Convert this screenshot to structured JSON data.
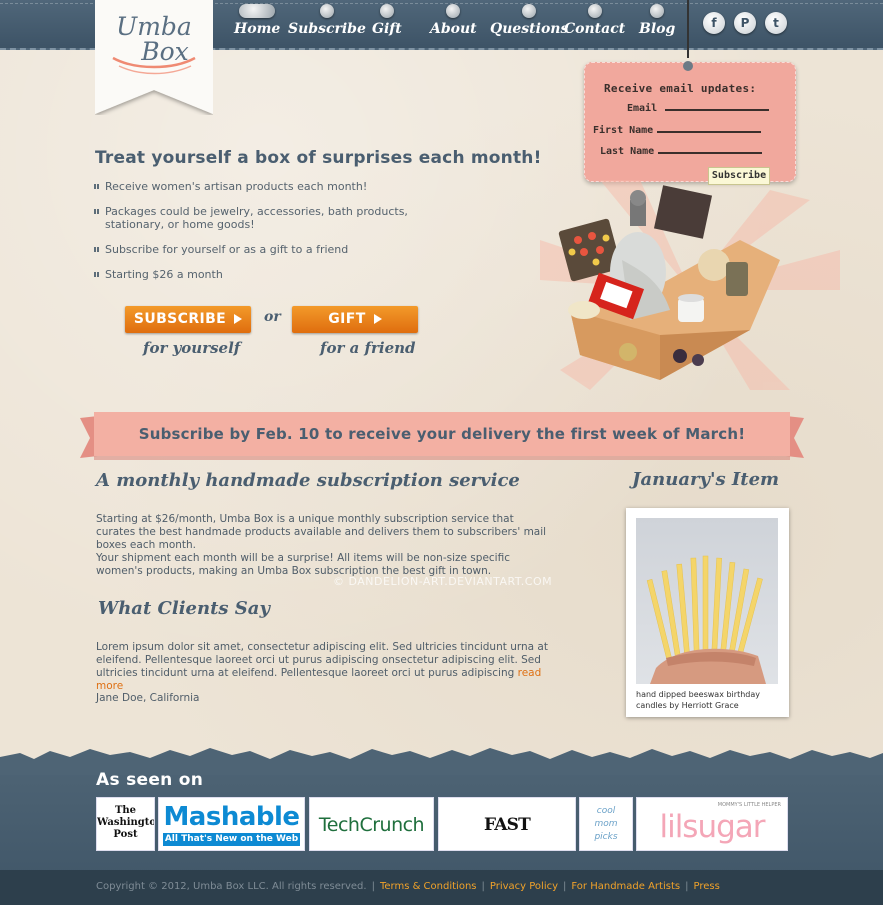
{
  "brand": {
    "logo_line1": "Umba",
    "logo_line2": "Box"
  },
  "nav": {
    "items": [
      {
        "label": "Home",
        "active": true
      },
      {
        "label": "Subscribe"
      },
      {
        "label": "Gift"
      },
      {
        "label": "About"
      },
      {
        "label": "Questions"
      },
      {
        "label": "Contact"
      },
      {
        "label": "Blog"
      }
    ],
    "social": [
      {
        "icon": "facebook-icon",
        "glyph": "f"
      },
      {
        "icon": "pinterest-icon",
        "glyph": "P"
      },
      {
        "icon": "twitter-icon",
        "glyph": "t"
      }
    ]
  },
  "email": {
    "title": "Receive email updates:",
    "email_label": "Email",
    "first_name_label": "First Name",
    "last_name_label": "Last Name",
    "subscribe_label": "Subscribe"
  },
  "hero": {
    "headline": "Treat yourself a box of surprises each month!",
    "features": [
      "Receive women's artisan products each month!",
      "Packages could be jewelry, accessories, bath products, stationary, or home goods!",
      "Subscribe for yourself or as a gift to a friend",
      "Starting $26 a month"
    ],
    "subscribe_label": "SUBSCRIBE",
    "subscribe_sub": "for yourself",
    "or_label": "or",
    "gift_label": "GIFT",
    "gift_sub": "for a friend"
  },
  "banner": {
    "text": "Subscribe by Feb. 10 to receive your delivery the first week of March!"
  },
  "about": {
    "heading": "A monthly handmade subscription service",
    "p1": "Starting at $26/month, Umba Box is a unique monthly subscription service that curates the best handmade products available and delivers them to subscribers' mail boxes each month.",
    "p2": "Your shipment each month will be a surprise! All items will be non-size specific women's products, making an Umba Box subscription the best gift in town."
  },
  "watermark": "© DANDELION-ART.DEVIANTART.COM",
  "testimonial": {
    "heading": "What Clients Say",
    "text": "Lorem ipsum dolor sit amet, consectetur adipiscing elit. Sed ultricies tincidunt urna at eleifend. Pellentesque laoreet orci ut purus adipiscing onsectetur adipiscing elit. Sed ultricies tincidunt urna at eleifend. Pellentesque laoreet orci ut purus adipiscing",
    "read_more": "read more",
    "author": "Jane Doe, California"
  },
  "january": {
    "heading": "January's Item",
    "caption": "hand dipped beeswax birthday candles by Herriott Grace"
  },
  "footer": {
    "seen_on": "As seen on",
    "press": [
      {
        "name": "The Washington Post",
        "line1": "The",
        "line2": "Washington",
        "line3": "Post"
      },
      {
        "name": "Mashable",
        "line1": "Mashable",
        "line2": "All That's New on the Web"
      },
      {
        "name": "TechCrunch",
        "line1": "TechCrunch"
      },
      {
        "name": "Fast Company",
        "line1": "FAST COMPANY"
      },
      {
        "name": "Cool Mom Picks",
        "line1": "cool",
        "line2": "mom",
        "line3": "picks"
      },
      {
        "name": "lilsugar",
        "line1": "lilsugar",
        "line2": "MOMMY'S LITTLE HELPER"
      }
    ],
    "copyright": "Copyright © 2012, Umba Box LLC. All rights reserved.",
    "links": [
      "Terms & Conditions",
      "Privacy Policy",
      "For Handmade Artists",
      "Press"
    ]
  },
  "colors": {
    "accent": "#df6d0e",
    "banner_pink": "#f2aea2",
    "navy": "#3d5366",
    "link": "#f0a22a"
  }
}
